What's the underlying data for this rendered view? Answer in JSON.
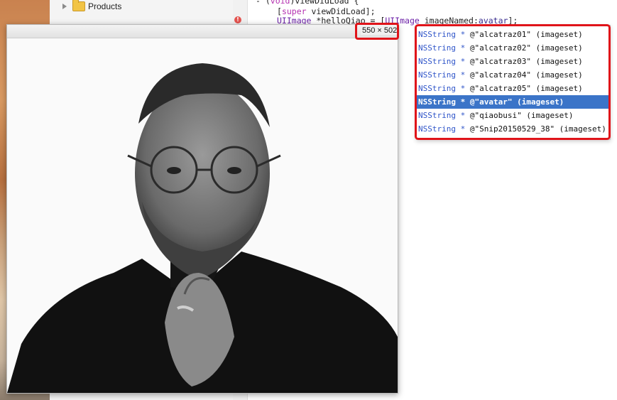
{
  "navigator": {
    "folder_label": "Products"
  },
  "editor": {
    "line1_prefix": "- (",
    "line1_void": "void",
    "line1_rest": ")viewDidLoad {",
    "line2_open": "[",
    "line2_super": "super",
    "line2_rest": " viewDidLoad];",
    "line3_type": "UIImage",
    "line3_mid": " *helloQiao = [",
    "line3_class": "UIImage",
    "line3_method": " imageNamed:",
    "line3_arg": "avatar",
    "line3_end": "];"
  },
  "preview": {
    "dimensions": "550 × 502"
  },
  "autocomplete": {
    "type_label": "NSString *",
    "items": [
      {
        "text": " @\"alcatraz01\" (imageset)",
        "selected": false
      },
      {
        "text": " @\"alcatraz02\" (imageset)",
        "selected": false
      },
      {
        "text": " @\"alcatraz03\" (imageset)",
        "selected": false
      },
      {
        "text": " @\"alcatraz04\" (imageset)",
        "selected": false
      },
      {
        "text": " @\"alcatraz05\" (imageset)",
        "selected": false
      },
      {
        "text": " @\"avatar\" (imageset)",
        "selected": true
      },
      {
        "text": " @\"qiaobusi\" (imageset)",
        "selected": false
      },
      {
        "text": " @\"Snip20150529_38\" (imageset)",
        "selected": false
      }
    ]
  },
  "colors": {
    "highlight_red": "#e0141a",
    "selection_blue": "#3b74c8",
    "type_blue": "#2f55c9"
  }
}
